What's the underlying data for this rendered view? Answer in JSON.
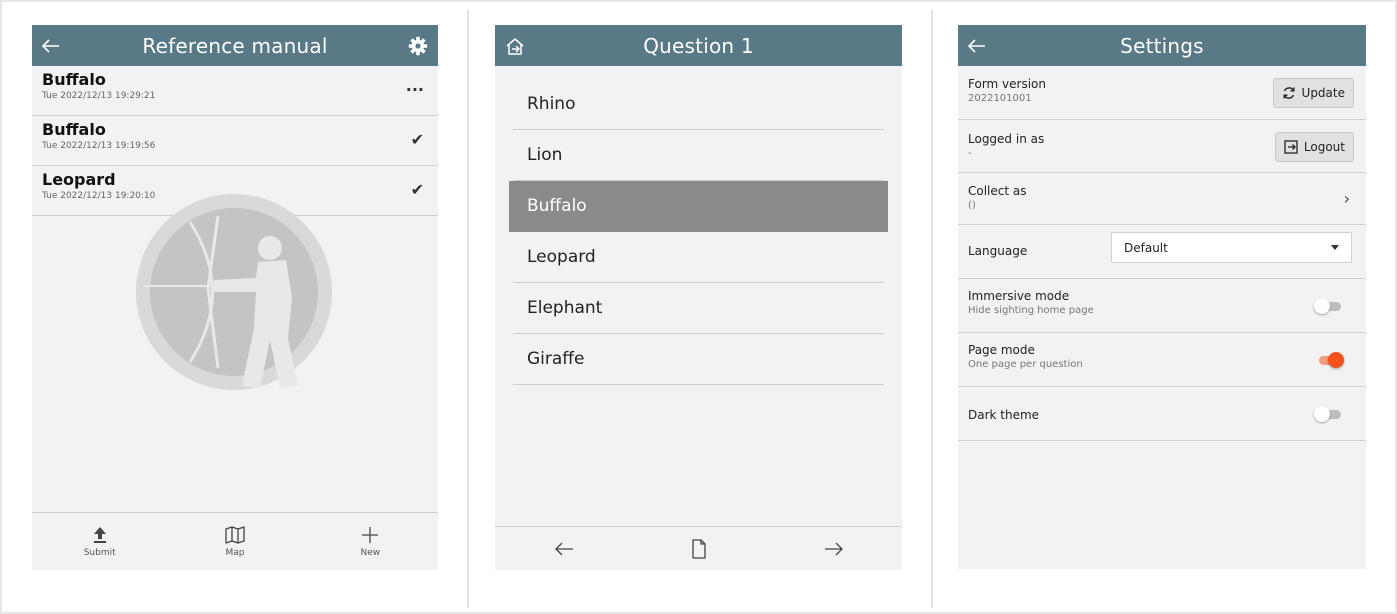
{
  "colors": {
    "appbar": "#587985",
    "accent": "#f4511e",
    "selected": "#8a8a8a"
  },
  "panel1": {
    "title": "Reference manual",
    "back_icon": "arrow-left-icon",
    "settings_icon": "gear-icon",
    "records": [
      {
        "name": "Buffalo",
        "date": "Tue 2022/12/13 19:29:21",
        "status": "···",
        "status_icon": "ellipsis-icon"
      },
      {
        "name": "Buffalo",
        "date": "Tue 2022/12/13 19:19:56",
        "status": "✔",
        "status_icon": "check-icon"
      },
      {
        "name": "Leopard",
        "date": "Tue 2022/12/13 19:20:10",
        "status": "✔",
        "status_icon": "check-icon"
      }
    ],
    "bottom": [
      {
        "label": "Submit",
        "icon": "upload-icon"
      },
      {
        "label": "Map",
        "icon": "map-icon"
      },
      {
        "label": "New",
        "icon": "plus-icon"
      }
    ]
  },
  "panel2": {
    "title": "Question 1",
    "home_icon": "home-icon",
    "options": [
      "Rhino",
      "Lion",
      "Buffalo",
      "Leopard",
      "Elephant",
      "Giraffe"
    ],
    "selected_option": "Buffalo",
    "nav": [
      "arrow-left-icon",
      "page-icon",
      "arrow-right-icon"
    ]
  },
  "panel3": {
    "title": "Settings",
    "form_version_label": "Form version",
    "form_version_value": "2022101001",
    "update_label": "Update",
    "logged_in_label": "Logged in as",
    "logged_in_value": "-",
    "logout_label": "Logout",
    "collect_as_label": "Collect as",
    "collect_as_value": "()",
    "language_label": "Language",
    "language_value": "Default",
    "immersive_label": "Immersive mode",
    "immersive_sub": "Hide sighting home page",
    "immersive_on": false,
    "page_mode_label": "Page mode",
    "page_mode_sub": "One page per question",
    "page_mode_on": true,
    "dark_theme_label": "Dark theme",
    "dark_theme_on": false
  }
}
